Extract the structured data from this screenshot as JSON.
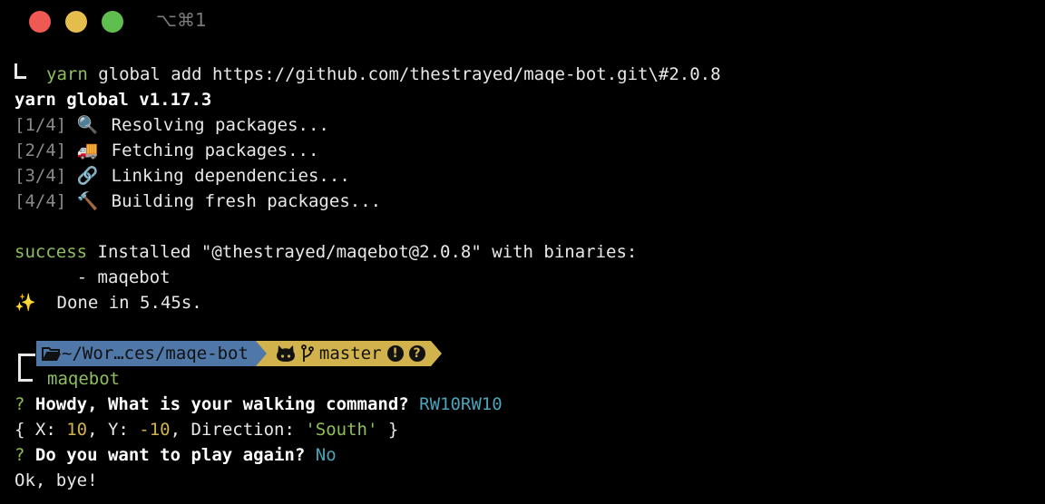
{
  "window": {
    "shortcut": "⌥⌘1"
  },
  "install": {
    "command": "yarn",
    "args": " global add https://github.com/thestrayed/maqe-bot.git\\#2.0.8",
    "header": "yarn global v1.17.3",
    "steps": [
      {
        "index": "[1/4]",
        "icon": "🔍",
        "text": "Resolving packages..."
      },
      {
        "index": "[2/4]",
        "icon": "🚚",
        "text": "Fetching packages..."
      },
      {
        "index": "[3/4]",
        "icon": "🔗",
        "text": "Linking dependencies..."
      },
      {
        "index": "[4/4]",
        "icon": "🔨",
        "text": "Building fresh packages..."
      }
    ],
    "success_word": "success",
    "success_text": " Installed \"@thestrayed/maqebot@2.0.8\" with binaries:",
    "binary": "      - maqebot",
    "done_icon": "✨",
    "done_text": "  Done in 5.45s."
  },
  "prompt": {
    "directory": "~/Wor…ces/maqe-bot",
    "branch": "master",
    "status_icons": [
      "!",
      "?"
    ],
    "command": "maqebot"
  },
  "session": {
    "q1_mark": "?",
    "q1_text": " Howdy, What is your walking command?",
    "q1_answer": " RW10RW10",
    "result_open": "{ X: ",
    "result_x": "10",
    "result_mid1": ", Y: ",
    "result_y": "-10",
    "result_mid2": ", Direction: ",
    "result_dir": "'South'",
    "result_close": " }",
    "q2_mark": "?",
    "q2_text": " Do you want to play again?",
    "q2_answer": " No",
    "farewell": "Ok, bye!"
  },
  "colors": {
    "close": "#ee5a52",
    "minimize": "#e5bd4d",
    "zoom": "#5fbe4e",
    "prompt_dir_bg": "#4f77a8",
    "prompt_git_bg": "#d2b24c"
  }
}
